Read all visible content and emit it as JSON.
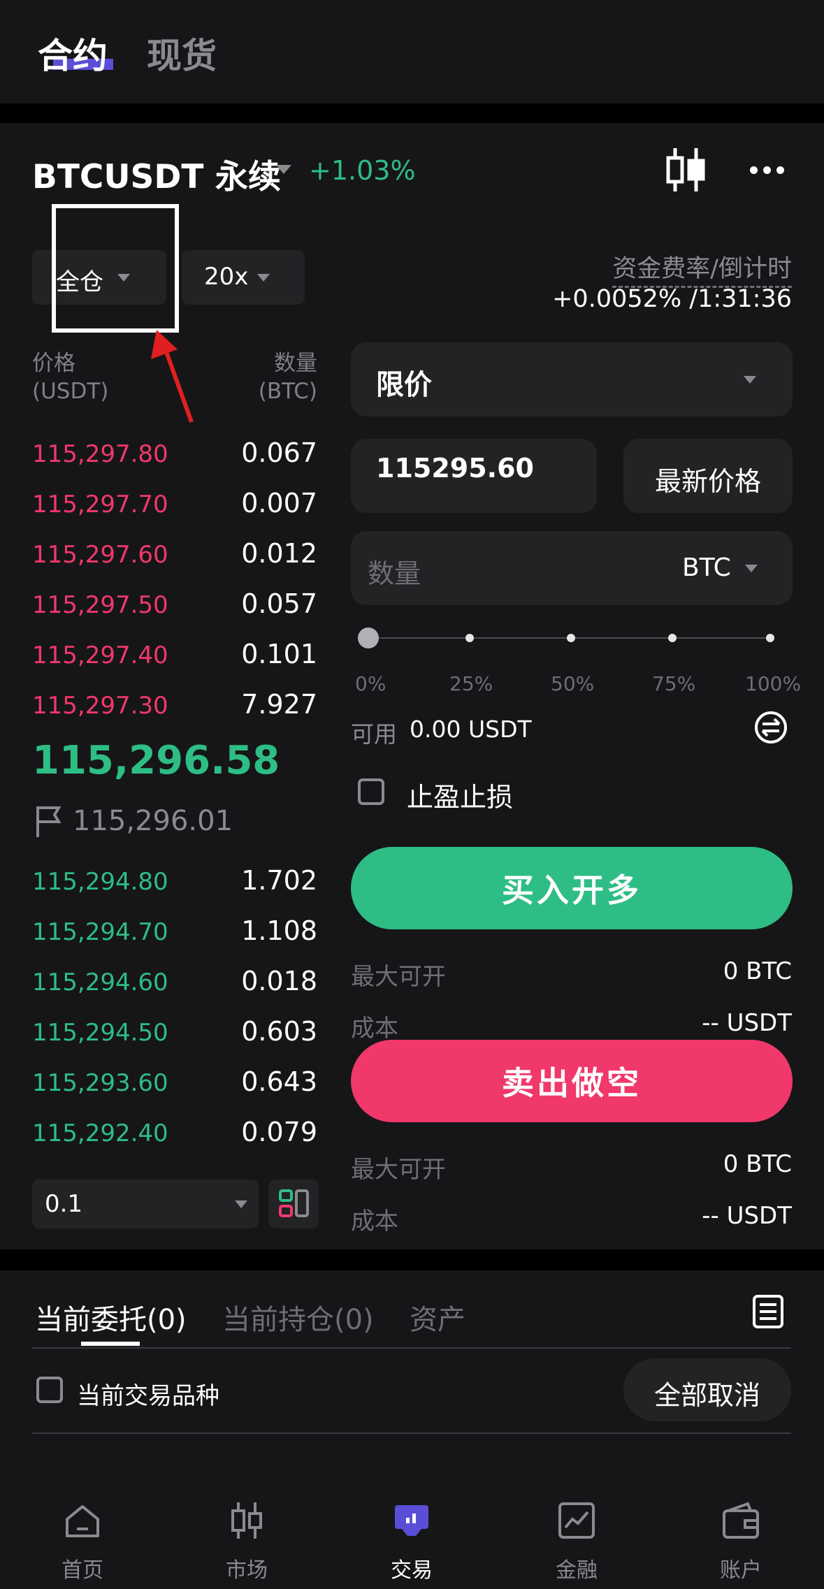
{
  "top_tabs": [
    "合约",
    "现货"
  ],
  "header": {
    "symbol": "BTCUSDT 永续",
    "change": "+1.03%",
    "margin_mode": "全仓",
    "leverage": "20x",
    "funding_label": "资金费率/倒计时",
    "funding_value": "+0.0052% /1:31:36"
  },
  "orderbook": {
    "price_header": "价格",
    "price_unit": "(USDT)",
    "qty_header": "数量",
    "qty_unit": "(BTC)",
    "asks": [
      {
        "price": "115,297.80",
        "qty": "0.067"
      },
      {
        "price": "115,297.70",
        "qty": "0.007"
      },
      {
        "price": "115,297.60",
        "qty": "0.012"
      },
      {
        "price": "115,297.50",
        "qty": "0.057"
      },
      {
        "price": "115,297.40",
        "qty": "0.101"
      },
      {
        "price": "115,297.30",
        "qty": "7.927"
      }
    ],
    "last_price": "115,296.58",
    "mark_price": "115,296.01",
    "bids": [
      {
        "price": "115,294.80",
        "qty": "1.702"
      },
      {
        "price": "115,294.70",
        "qty": "1.108"
      },
      {
        "price": "115,294.60",
        "qty": "0.018"
      },
      {
        "price": "115,294.50",
        "qty": "0.603"
      },
      {
        "price": "115,293.60",
        "qty": "0.643"
      },
      {
        "price": "115,292.40",
        "qty": "0.079"
      }
    ],
    "depth_step": "0.1"
  },
  "order_form": {
    "order_type": "限价",
    "price_value": "115295.60",
    "latest_price_button": "最新价格",
    "qty_placeholder": "数量",
    "qty_unit": "BTC",
    "slider_percent": 0,
    "slider_labels": [
      "0%",
      "25%",
      "50%",
      "75%",
      "100%"
    ],
    "available_label": "可用",
    "available_value": "0.00 USDT",
    "tpsl_label": "止盈止损",
    "buy_button": "买入开多",
    "sell_button": "卖出做空",
    "buy_info": {
      "max_label": "最大可开",
      "max_value": "0 BTC",
      "cost_label": "成本",
      "cost_value": "-- USDT"
    },
    "sell_info": {
      "max_label": "最大可开",
      "max_value": "0 BTC",
      "cost_label": "成本",
      "cost_value": "-- USDT"
    }
  },
  "orders_section": {
    "tabs": [
      "当前委托(0)",
      "当前持仓(0)",
      "资产"
    ],
    "filter_label": "当前交易品种",
    "cancel_all": "全部取消"
  },
  "bottom_nav": [
    "首页",
    "市场",
    "交易",
    "金融",
    "账户"
  ],
  "colors": {
    "buy": "#2ebd85",
    "sell": "#f0386b",
    "accent": "#5b4ed6",
    "annotation": "#e02020"
  }
}
